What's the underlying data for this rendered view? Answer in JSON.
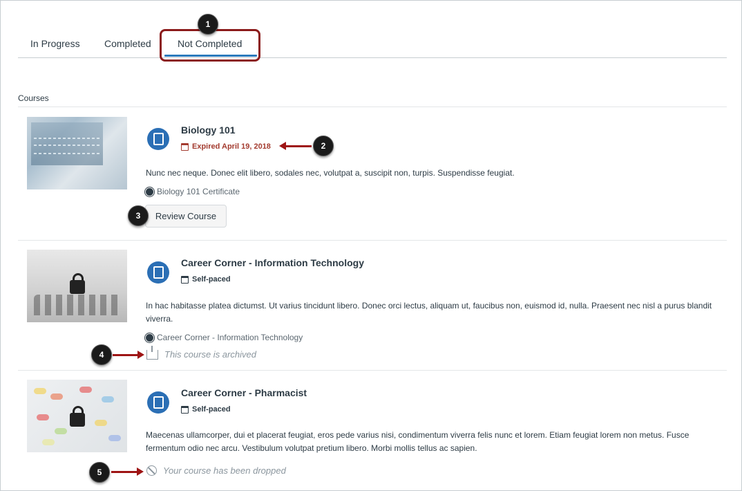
{
  "tabs": [
    {
      "label": "In Progress"
    },
    {
      "label": "Completed"
    },
    {
      "label": "Not Completed"
    }
  ],
  "section_label": "Courses",
  "courses": [
    {
      "title": "Biology 101",
      "meta": "Expired April 19, 2018",
      "description": "Nunc nec neque. Donec elit libero, sodales nec, volutpat a, suscipit non, turpis. Suspendisse feugiat.",
      "certificate": "Biology 101 Certificate",
      "action_label": "Review Course"
    },
    {
      "title": "Career Corner - Information Technology",
      "meta": "Self-paced",
      "description": "In hac habitasse platea dictumst. Ut varius tincidunt libero. Donec orci lectus, aliquam ut, faucibus non, euismod id, nulla. Praesent nec nisl a purus blandit viverra.",
      "certificate": "Career Corner - Information Technology",
      "status": "This course is archived"
    },
    {
      "title": "Career Corner - Pharmacist",
      "meta": "Self-paced",
      "description": "Maecenas ullamcorper, dui et placerat feugiat, eros pede varius nisi, condimentum viverra felis nunc et lorem. Etiam feugiat lorem non metus. Fusce fermentum odio nec arcu. Vestibulum volutpat pretium libero. Morbi mollis tellus ac sapien.",
      "status": "Your course has been dropped"
    }
  ],
  "callouts": [
    "1",
    "2",
    "3",
    "4",
    "5"
  ],
  "colors": {
    "accent": "#2b7abc",
    "course_icon": "#2b6fb5",
    "expired": "#a33b2f",
    "callout_border": "#8b1a1a"
  },
  "icons": {
    "course": "book-icon",
    "calendar": "calendar-icon",
    "certificate": "badge-icon",
    "archived": "archive-icon",
    "dropped": "no-entry-icon",
    "locked": "lock-icon"
  }
}
